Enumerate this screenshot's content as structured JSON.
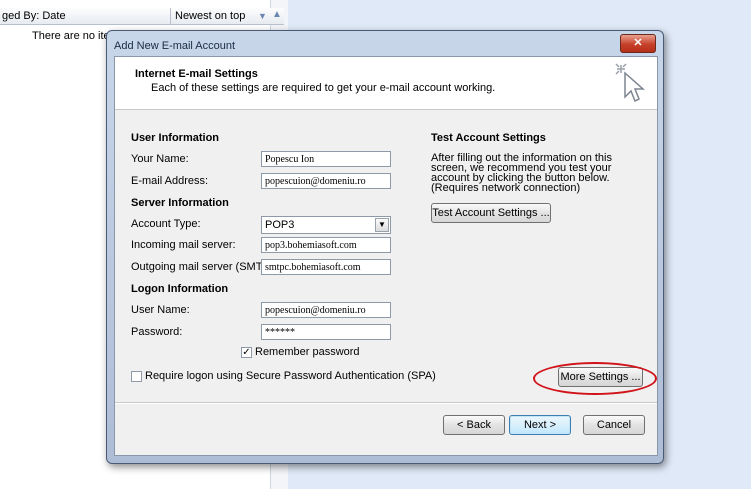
{
  "background": {
    "arrange_left": "ged By: Date",
    "arrange_right": "Newest on top",
    "empty_message": "There are no iten"
  },
  "dialog": {
    "title": "Add New E-mail Account",
    "close_glyph": "✕",
    "header_title": "Internet E-mail Settings",
    "header_subtitle": "Each of these settings are required to get your e-mail account working.",
    "user_info": {
      "heading": "User Information",
      "name_label": "Your Name:",
      "name_value": "Popescu Ion",
      "email_label": "E-mail Address:",
      "email_value": "popescuion@domeniu.ro"
    },
    "server_info": {
      "heading": "Server Information",
      "account_type_label": "Account Type:",
      "account_type_value": "POP3",
      "incoming_label": "Incoming mail server:",
      "incoming_value": "pop3.bohemiasoft.com",
      "outgoing_label": "Outgoing mail server (SMTP):",
      "outgoing_value": "smtpc.bohemiasoft.com"
    },
    "logon_info": {
      "heading": "Logon Information",
      "username_label": "User Name:",
      "username_value": "popescuion@domeniu.ro",
      "password_label": "Password:",
      "password_value": "******",
      "remember_label": "Remember password",
      "remember_checked": true,
      "spa_label": "Require logon using Secure Password Authentication (SPA)",
      "spa_checked": false
    },
    "test": {
      "heading": "Test Account Settings",
      "description": "After filling out the information on this screen, we recommend you test your account by clicking the button below. (Requires network connection)",
      "button": "Test Account Settings ..."
    },
    "more_settings_button": "More Settings ...",
    "back_button": "< Back",
    "next_button": "Next >",
    "cancel_button": "Cancel",
    "highlight_color": "#d0141a"
  }
}
